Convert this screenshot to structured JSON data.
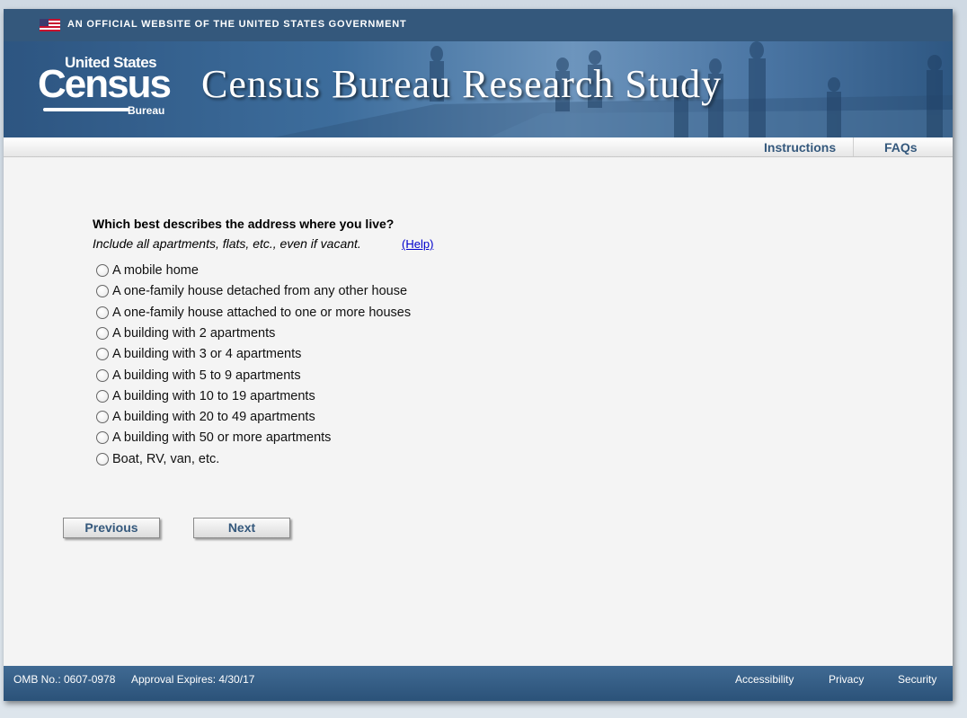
{
  "gov_banner": {
    "text": "AN OFFICIAL WEBSITE OF THE UNITED STATES GOVERNMENT"
  },
  "logo": {
    "top": "United States",
    "main": "Census",
    "sub": "Bureau"
  },
  "header": {
    "title": "Census Bureau Research Study"
  },
  "nav": {
    "instructions": "Instructions",
    "faqs": "FAQs"
  },
  "question": {
    "title": "Which best describes the address where you live?",
    "instruction": "Include all apartments, flats, etc., even if vacant.",
    "help_link": "(Help)",
    "options": [
      "A mobile home",
      "A one-family house detached from any other house",
      "A one-family house attached to one or more houses",
      "A building with 2 apartments",
      "A building with 3 or 4 apartments",
      "A building with 5 to 9 apartments",
      "A building with 10 to 19 apartments",
      "A building with 20 to 49 apartments",
      "A building with 50 or more apartments",
      "Boat, RV, van, etc."
    ]
  },
  "buttons": {
    "previous": "Previous",
    "next": "Next"
  },
  "footer": {
    "omb": "OMB No.: 0607-0978",
    "approval": "Approval Expires: 4/30/17",
    "accessibility": "Accessibility",
    "privacy": "Privacy",
    "security": "Security"
  },
  "colors": {
    "brand_blue": "#34587c",
    "footer_blue": "#2b5279",
    "link_blue": "#0000cc"
  }
}
